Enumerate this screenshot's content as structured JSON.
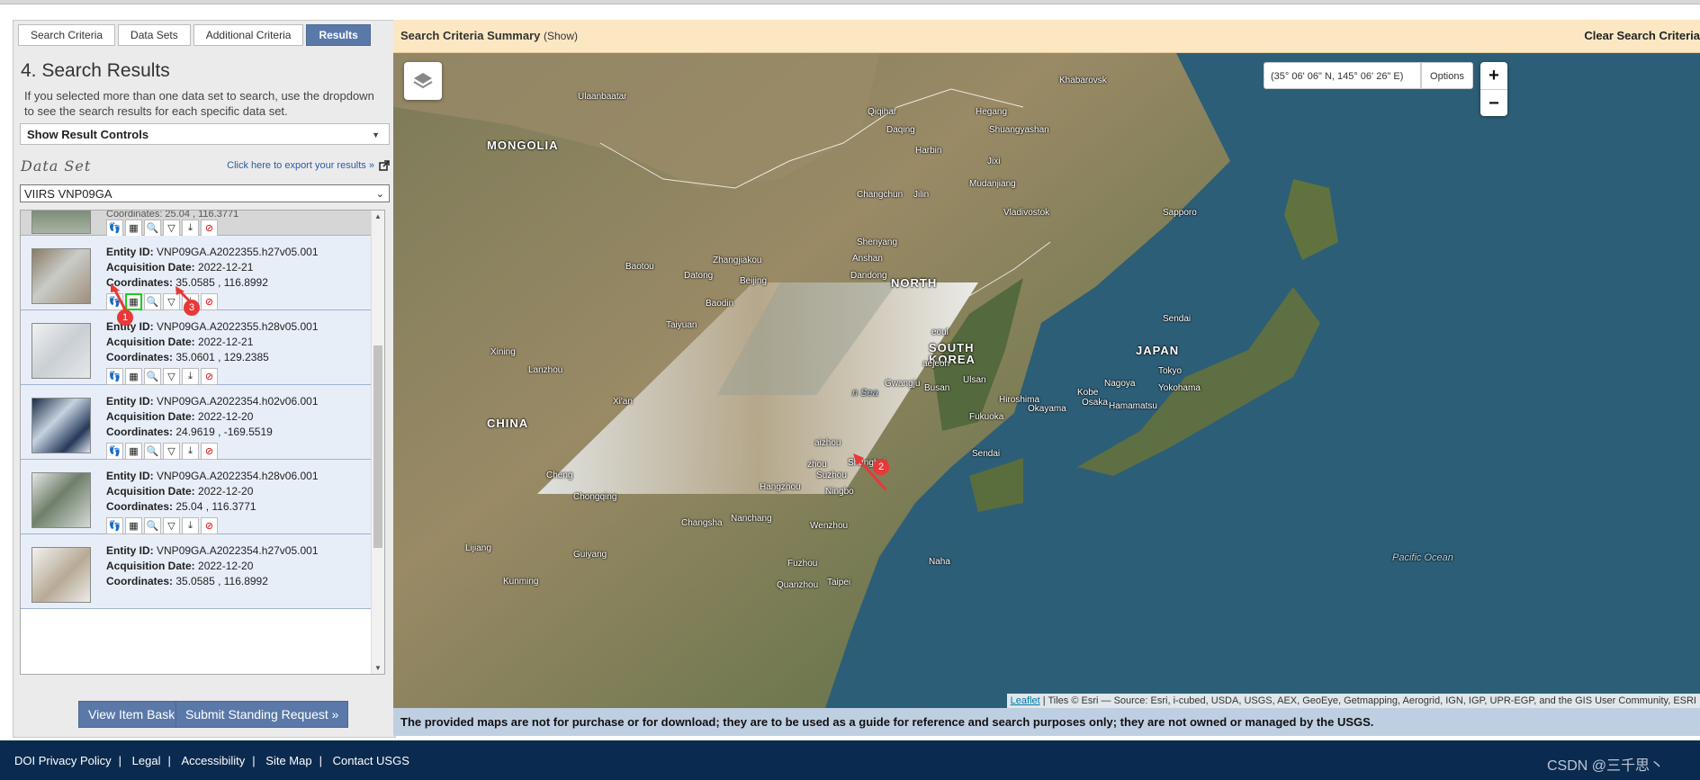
{
  "tabs": [
    {
      "label": "Search Criteria",
      "active": false
    },
    {
      "label": "Data Sets",
      "active": false
    },
    {
      "label": "Additional Criteria",
      "active": false
    },
    {
      "label": "Results",
      "active": true
    }
  ],
  "results": {
    "title": "4. Search Results",
    "intro": "If you selected more than one data set to search, use the dropdown to see the search results for each specific data set.",
    "controls_label": "Show Result Controls",
    "dataset_label": "Data Set",
    "export_link": "Click here to export your results »",
    "dataset_value": "VIIRS VNP09GA",
    "partial_row": "Coordinates: 25.04 , 116.3771",
    "labels": {
      "entity": "Entity ID:",
      "date": "Acquisition Date:",
      "coords": "Coordinates:"
    },
    "rows": [
      {
        "entity": "VNP09GA.A2022355.h27v05.001",
        "date": "2022-12-21",
        "coords": "35.0585 , 116.8992"
      },
      {
        "entity": "VNP09GA.A2022355.h28v05.001",
        "date": "2022-12-21",
        "coords": "35.0601 , 129.2385"
      },
      {
        "entity": "VNP09GA.A2022354.h02v06.001",
        "date": "2022-12-20",
        "coords": "24.9619 , -169.5519"
      },
      {
        "entity": "VNP09GA.A2022354.h28v06.001",
        "date": "2022-12-20",
        "coords": "25.04 , 116.3771"
      },
      {
        "entity": "VNP09GA.A2022354.h27v05.001",
        "date": "2022-12-20",
        "coords": "35.0585 , 116.8992"
      }
    ],
    "row_icons": [
      "footprint-icon",
      "overlay-icon",
      "metadata-icon",
      "compare-icon",
      "download-icon",
      "exclude-icon"
    ],
    "basket_button": "View Item Basket »",
    "standing_button": "Submit Standing Request »"
  },
  "map": {
    "summary_title": "Search Criteria Summary",
    "summary_toggle": "(Show)",
    "clear_label": "Clear Search Criteria",
    "coords_readout": "(35° 06' 06\" N, 145° 06' 26\" E)",
    "options_label": "Options",
    "zoom_in": "+",
    "zoom_out": "−",
    "attribution_link": "Leaflet",
    "attribution_text": " | Tiles © Esri — Source: Esri, i-cubed, USDA, USGS, AEX, GeoEye, Getmapping, Aerogrid, IGN, IGP, UPR-EGP, and the GIS User Community, ESRI",
    "disclaimer": "The provided maps are not for purchase or for download; they are to be used as a guide for reference and search purposes only; they are not owned or managed by the USGS.",
    "places": {
      "mongolia": "MONGOLIA",
      "china": "CHINA",
      "north_korea": "NORTH",
      "south_korea1": "SOUTH",
      "south_korea2": "KOREA",
      "japan": "JAPAN",
      "ulaanbaatar": "Ulaanbaatar",
      "khabarovsk": "Khabarovsk",
      "qiqihar": "Qiqihar",
      "hegang": "Hegang",
      "daqing": "Daqing",
      "shuangyashan": "Shuangyashan",
      "harbin": "Harbin",
      "jixi": "Jixi",
      "mudanjiang": "Mudanjiang",
      "changchun": "Changchun",
      "jilin": "Jilin",
      "vladivostok": "Vladivostok",
      "sapporo": "Sapporo",
      "shenyang": "Shenyang",
      "anshan": "Anshan",
      "dandong": "Dandong",
      "zhangjiakou": "Zhangjiakou",
      "baotou": "Baotou",
      "datong": "Datong",
      "beijing": "Beijing",
      "baoding": "Baodin",
      "taiyuan": "Taiyuan",
      "xining": "Xining",
      "lanzhou": "Lanzhou",
      "xian": "Xi'an",
      "seoul": "eoul",
      "daejeon": "aejeon",
      "gwangju": "Gwangju",
      "busan": "Busan",
      "ulsan": "Ulsan",
      "hiroshima": "Hiroshima",
      "kobe": "Kobe",
      "osaka": "Osaka",
      "okayama": "Okayama",
      "nagoya": "Nagoya",
      "hamamatsu": "Hamamatsu",
      "tokyo": "Tokyo",
      "yokohama": "Yokohama",
      "sendai": "Sendai",
      "fukuoka": "Fukuoka",
      "sendai2": "Sendai",
      "chengdu": "Cheng",
      "chongqing": "Chongqing",
      "suzhou": "Suzhou",
      "shanghai": "Shanghai",
      "hangzhou": "Hangzhou",
      "ningbo": "Ningbo",
      "changzhou": "zhou",
      "wuxi": "aizhou",
      "changsha": "Changsha",
      "nanchang": "Nanchang",
      "wenzhou": "Wenzhou",
      "lijiang": "Lijiang",
      "guiyang": "Guiyang",
      "fuzhou": "Fuzhou",
      "kunming": "Kunming",
      "quanzhou": "Quanzhou",
      "taipei": "Taipei",
      "naha": "Naha",
      "pacific": "Pacific Ocean",
      "eastsea": "n Sea"
    },
    "markers": [
      "1",
      "2",
      "3"
    ]
  },
  "footer": {
    "links": [
      "DOI Privacy Policy",
      "Legal",
      "Accessibility",
      "Site Map",
      "Contact USGS"
    ],
    "separator": "|",
    "watermark": "CSDN @三千思丶"
  }
}
